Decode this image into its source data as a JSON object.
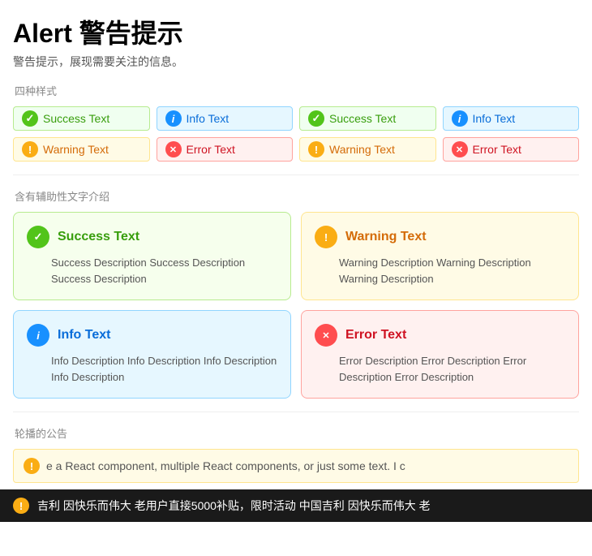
{
  "page": {
    "title": "Alert 警告提示",
    "subtitle": "警告提示，展现需要关注的信息。"
  },
  "sections": {
    "four_styles_label": "四种样式",
    "with_desc_label": "含有辅助性文字介绍",
    "marquee_label": "轮播的公告"
  },
  "inline_row1": [
    {
      "type": "success",
      "label": "Success Text"
    },
    {
      "type": "info",
      "label": "Info Text"
    },
    {
      "type": "success",
      "label": "Success Text"
    },
    {
      "type": "info",
      "label": "Info Text"
    }
  ],
  "inline_row2": [
    {
      "type": "warning",
      "label": "Warning Text"
    },
    {
      "type": "error",
      "label": "Error Text"
    },
    {
      "type": "warning",
      "label": "Warning Text"
    },
    {
      "type": "error",
      "label": "Error Text"
    }
  ],
  "block_alerts": [
    {
      "type": "success",
      "title": "Success Text",
      "desc": "Success Description Success Description Success Description"
    },
    {
      "type": "warning",
      "title": "Warning Text",
      "desc": "Warning Description Warning Description Warning Description"
    },
    {
      "type": "info",
      "title": "Info Text",
      "desc": "Info Description Info Description Info Description Info Description"
    },
    {
      "type": "error",
      "title": "Error Text",
      "desc": "Error Description Error Description Error Description Error Description"
    }
  ],
  "marquee_text": "e a React component, multiple React components, or just some text.   I c",
  "ticker_text": "吉利  因快乐而伟大  老用户直接5000补贴，限时活动  中国吉利  因快乐而伟大  老"
}
